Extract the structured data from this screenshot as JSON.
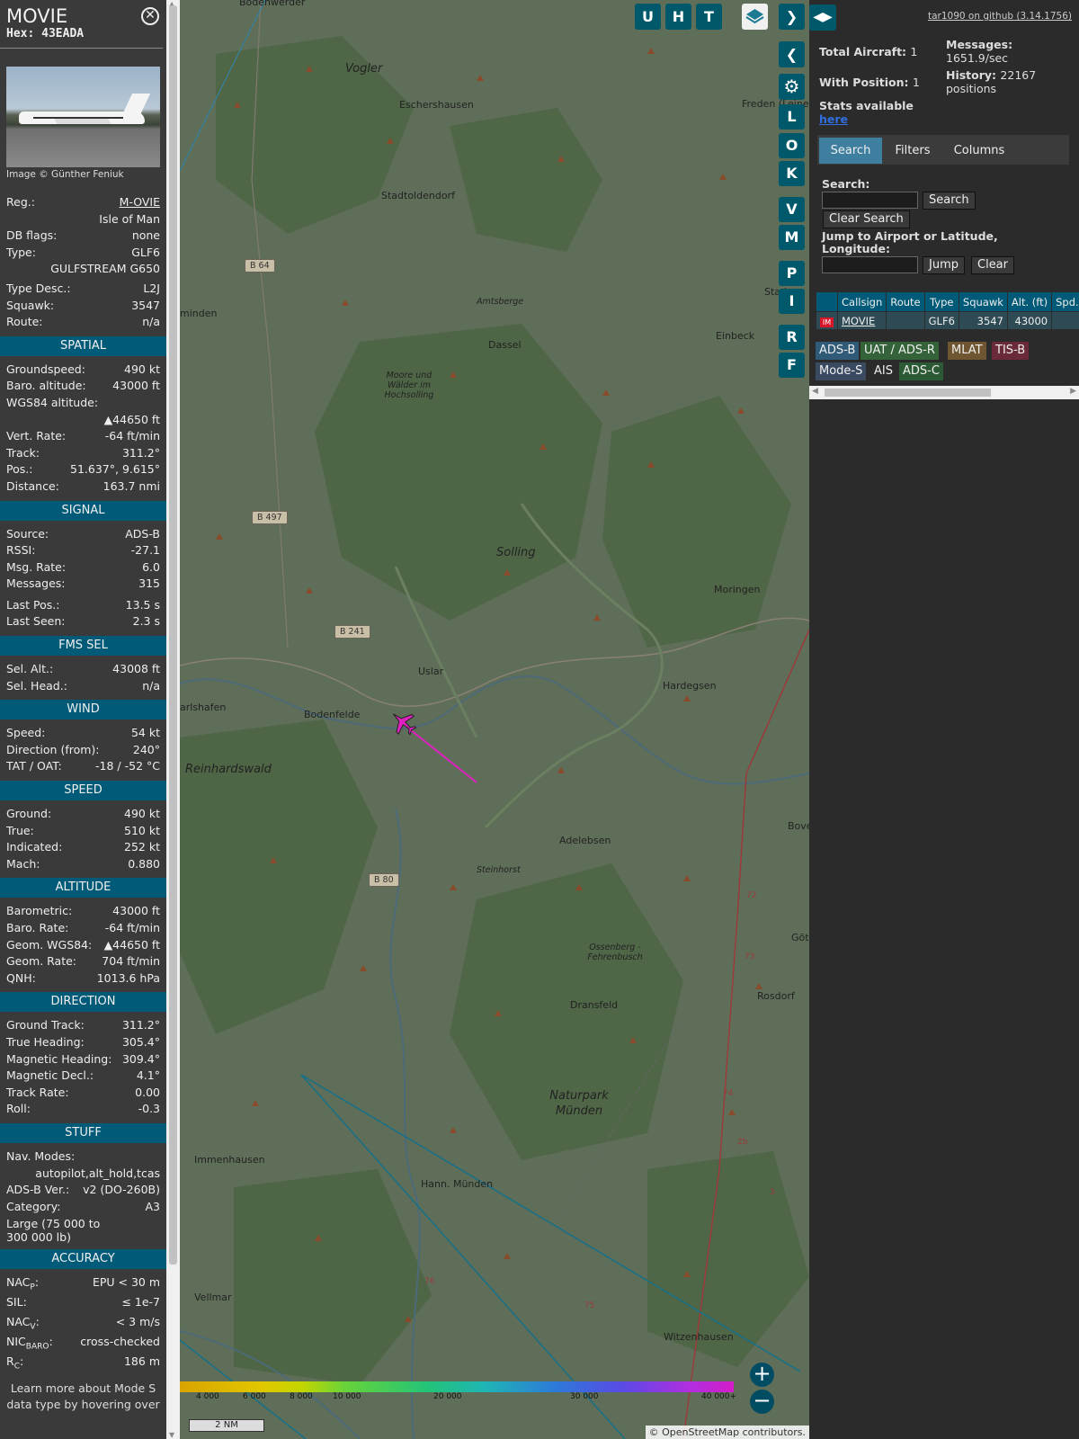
{
  "info": {
    "callsign": "MOVIE",
    "hex": "Hex: 43EADA",
    "close_icon": "⊗",
    "photo_credit": "Image © Günther Feniuk",
    "reg_label": "Reg.:",
    "reg_value": "M-OVIE",
    "country": "Isle of Man",
    "dbflags_label": "DB flags:",
    "dbflags_value": "none",
    "type_label": "Type:",
    "type_value": "GLF6",
    "type_name": "GULFSTREAM G650",
    "typedesc_label": "Type Desc.:",
    "typedesc_value": "L2J",
    "squawk_label": "Squawk:",
    "squawk_value": "3547",
    "route_label": "Route:",
    "route_value": "n/a",
    "sections": {
      "spatial": "SPATIAL",
      "signal": "SIGNAL",
      "fms": "FMS SEL",
      "wind": "WIND",
      "speed": "SPEED",
      "altitude": "ALTITUDE",
      "direction": "DIRECTION",
      "stuff": "STUFF",
      "accuracy": "ACCURACY"
    },
    "spatial": {
      "gs_l": "Groundspeed:",
      "gs_v": "490 kt",
      "baro_l": "Baro. altitude:",
      "baro_v": "43000 ft",
      "wgs_l": "WGS84 altitude:",
      "wgs_v": "▲44650 ft",
      "vr_l": "Vert. Rate:",
      "vr_v": "-64 ft/min",
      "trk_l": "Track:",
      "trk_v": "311.2°",
      "pos_l": "Pos.:",
      "pos_v": "51.637°, 9.615°",
      "dist_l": "Distance:",
      "dist_v": "163.7 nmi"
    },
    "signal": {
      "src_l": "Source:",
      "src_v": "ADS-B",
      "rssi_l": "RSSI:",
      "rssi_v": "-27.1",
      "rate_l": "Msg. Rate:",
      "rate_v": "6.0",
      "msgs_l": "Messages:",
      "msgs_v": "315",
      "lastpos_l": "Last Pos.:",
      "lastpos_v": "13.5 s",
      "lastseen_l": "Last Seen:",
      "lastseen_v": "2.3 s"
    },
    "fms": {
      "alt_l": "Sel. Alt.:",
      "alt_v": "43008 ft",
      "head_l": "Sel. Head.:",
      "head_v": "n/a"
    },
    "wind": {
      "spd_l": "Speed:",
      "spd_v": "54 kt",
      "dir_l": "Direction (from):",
      "dir_v": "240°",
      "tat_l": "TAT / OAT:",
      "tat_v": "-18 / -52 °C"
    },
    "speed": {
      "gnd_l": "Ground:",
      "gnd_v": "490 kt",
      "true_l": "True:",
      "true_v": "510 kt",
      "ind_l": "Indicated:",
      "ind_v": "252 kt",
      "mach_l": "Mach:",
      "mach_v": "0.880"
    },
    "altitude": {
      "baro_l": "Barometric:",
      "baro_v": "43000 ft",
      "brate_l": "Baro. Rate:",
      "brate_v": "-64 ft/min",
      "geom_l": "Geom. WGS84:",
      "geom_v": "▲44650 ft",
      "grate_l": "Geom. Rate:",
      "grate_v": "704 ft/min",
      "qnh_l": "QNH:",
      "qnh_v": "1013.6 hPa"
    },
    "direction": {
      "gt_l": "Ground Track:",
      "gt_v": "311.2°",
      "th_l": "True Heading:",
      "th_v": "305.4°",
      "mh_l": "Magnetic Heading:",
      "mh_v": "309.4°",
      "md_l": "Magnetic Decl.:",
      "md_v": "4.1°",
      "tr_l": "Track Rate:",
      "tr_v": "0.00",
      "roll_l": "Roll:",
      "roll_v": "-0.3"
    },
    "stuff": {
      "nav_l": "Nav. Modes:",
      "nav_v": "autopilot,alt_hold,tcas",
      "adsb_l": "ADS-B Ver.:",
      "adsb_v": "v2 (DO-260B)",
      "cat_l": "Category:",
      "cat_v": "A3",
      "cat_desc": "Large (75 000 to 300 000 lb)"
    },
    "accuracy": {
      "nacp_l": "NAC",
      "nacp_sub": "P",
      "nacp_v": "EPU < 30 m",
      "sil_l": "SIL:",
      "sil_v": "≤ 1e-7",
      "nacv_l": "NAC",
      "nacv_sub": "V",
      "nacv_v": "< 3 m/s",
      "nic_l": "NIC",
      "nic_sub": "BARO",
      "nic_v": "cross-checked",
      "rc_l": "R",
      "rc_sub": "C",
      "rc_v": "186 m"
    },
    "learn": "Learn more about Mode S data type by hovering over"
  },
  "map": {
    "places": [
      {
        "name": "Bodenwerder",
        "cls": ""
      },
      {
        "name": "Vogler",
        "cls": "big"
      },
      {
        "name": "Eschershausen",
        "cls": ""
      },
      {
        "name": "Freden (Leine)",
        "cls": ""
      },
      {
        "name": "Stadtoldendorf",
        "cls": ""
      },
      {
        "name": "Amtsberge",
        "cls": "big"
      },
      {
        "name": "Einbeck",
        "cls": ""
      },
      {
        "name": "minden",
        "cls": ""
      },
      {
        "name": "Dassel",
        "cls": ""
      },
      {
        "name": "Moore und Wälder im Hochsolling",
        "cls": "big"
      },
      {
        "name": "Solling",
        "cls": "big"
      },
      {
        "name": "Moringen",
        "cls": ""
      },
      {
        "name": "Uslar",
        "cls": ""
      },
      {
        "name": "Hardegsen",
        "cls": ""
      },
      {
        "name": "arlshafen",
        "cls": ""
      },
      {
        "name": "Bodenfelde",
        "cls": ""
      },
      {
        "name": "Reinhardswald",
        "cls": "big"
      },
      {
        "name": "Adelebsen",
        "cls": ""
      },
      {
        "name": "Steinhorst",
        "cls": "big"
      },
      {
        "name": "Göt",
        "cls": ""
      },
      {
        "name": "Ossenberg - Fehrenbusch",
        "cls": "big"
      },
      {
        "name": "Dransfeld",
        "cls": ""
      },
      {
        "name": "Rosdorf",
        "cls": ""
      },
      {
        "name": "Naturpark Münden",
        "cls": "big"
      },
      {
        "name": "Immenhausen",
        "cls": ""
      },
      {
        "name": "Hann. Münden",
        "cls": ""
      },
      {
        "name": "Vellmar",
        "cls": ""
      },
      {
        "name": "Witzenhausen",
        "cls": ""
      },
      {
        "name": "Bove",
        "cls": ""
      },
      {
        "name": "Stad",
        "cls": ""
      }
    ],
    "roads": [
      "B 64",
      "B 497",
      "B 241",
      "B 80"
    ],
    "buttons": {
      "u": "U",
      "h": "H",
      "t": "T",
      "next": "❯",
      "prev": "❮",
      "l": "L",
      "o": "O",
      "k": "K",
      "v": "V",
      "m": "M",
      "p": "P",
      "i": "I",
      "r": "R",
      "f": "F"
    },
    "zoom_in": "+",
    "zoom_out": "−",
    "altitude_ticks": [
      "4 000",
      "6 000",
      "8 000",
      "10 000",
      "20 000",
      "30 000",
      "40 000+"
    ],
    "scale": "2 NM",
    "attribution": "© OpenStreetMap contributors.",
    "colors": {
      "selected_aircraft": "#e020c0",
      "trail": "#e020c0"
    }
  },
  "sidebar": {
    "github": "tar1090 on github (3.14.1756)",
    "toggle_icon": "◀▶",
    "total_label": "Total Aircraft:",
    "total_value": "1",
    "withpos_label": "With Position:",
    "withpos_value": "1",
    "messages_label": "Messages:",
    "messages_value": "1651.9/sec",
    "history_label": "History:",
    "history_value": "22167 positions",
    "stats_label": "Stats available",
    "stats_link": "here",
    "tabs": [
      "Search",
      "Filters",
      "Columns"
    ],
    "search_label": "Search:",
    "search_btn": "Search",
    "clear_search_btn": "Clear Search",
    "jump_label": "Jump to Airport or Latitude, Longitude:",
    "jump_btn": "Jump",
    "clear_btn": "Clear",
    "columns": [
      "",
      "Callsign",
      "Route",
      "Type",
      "Squawk",
      "Alt. (ft)",
      "Spd."
    ],
    "rows": [
      {
        "flag": "IM",
        "callsign": "MOVIE",
        "route": "",
        "type": "GLF6",
        "squawk": "3547",
        "alt": "43000",
        "spd": ""
      }
    ],
    "legend": [
      {
        "label": "ADS-B",
        "bg": "#2f5a78",
        "fg": "#eee"
      },
      {
        "label": "UAT / ADS-R",
        "bg": "#34633a",
        "fg": "#eee"
      },
      {
        "label": "MLAT",
        "bg": "#6f5630",
        "fg": "#eee"
      },
      {
        "label": "TIS-B",
        "bg": "#6a2a3a",
        "fg": "#eee"
      },
      {
        "label": "Mode-S",
        "bg": "#3a4a60",
        "fg": "#eee"
      },
      {
        "label": "AIS",
        "bg": "#2b2b2b",
        "fg": "#eee"
      },
      {
        "label": "ADS-C",
        "bg": "#2c5a34",
        "fg": "#eee"
      }
    ]
  }
}
